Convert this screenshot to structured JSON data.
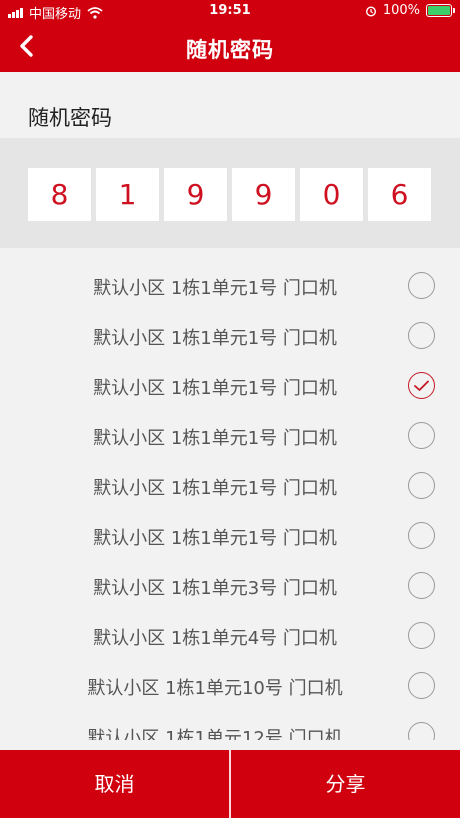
{
  "status_bar": {
    "carrier": "中国移动",
    "time": "19:51",
    "battery": "100%"
  },
  "header": {
    "title": "随机密码"
  },
  "section": {
    "title": "随机密码"
  },
  "password": {
    "digits": [
      "8",
      "1",
      "9",
      "9",
      "0",
      "6"
    ]
  },
  "devices": [
    {
      "label": "默认小区 1栋1单元1号  门口机",
      "checked": false
    },
    {
      "label": "默认小区 1栋1单元1号  门口机",
      "checked": false
    },
    {
      "label": "默认小区 1栋1单元1号  门口机",
      "checked": true
    },
    {
      "label": "默认小区 1栋1单元1号  门口机",
      "checked": false
    },
    {
      "label": "默认小区 1栋1单元1号  门口机",
      "checked": false
    },
    {
      "label": "默认小区 1栋1单元1号  门口机",
      "checked": false
    },
    {
      "label": "默认小区 1栋1单元3号  门口机",
      "checked": false
    },
    {
      "label": "默认小区 1栋1单元4号  门口机",
      "checked": false
    },
    {
      "label": "默认小区 1栋1单元10号  门口机",
      "checked": false
    },
    {
      "label": "默认小区 1栋1单元12号  门口机",
      "checked": false
    }
  ],
  "footer": {
    "cancel_label": "取消",
    "share_label": "分享"
  },
  "colors": {
    "brand_red": "#d0000f",
    "digit_red": "#cf1020",
    "battery_green": "#3cd06b"
  }
}
